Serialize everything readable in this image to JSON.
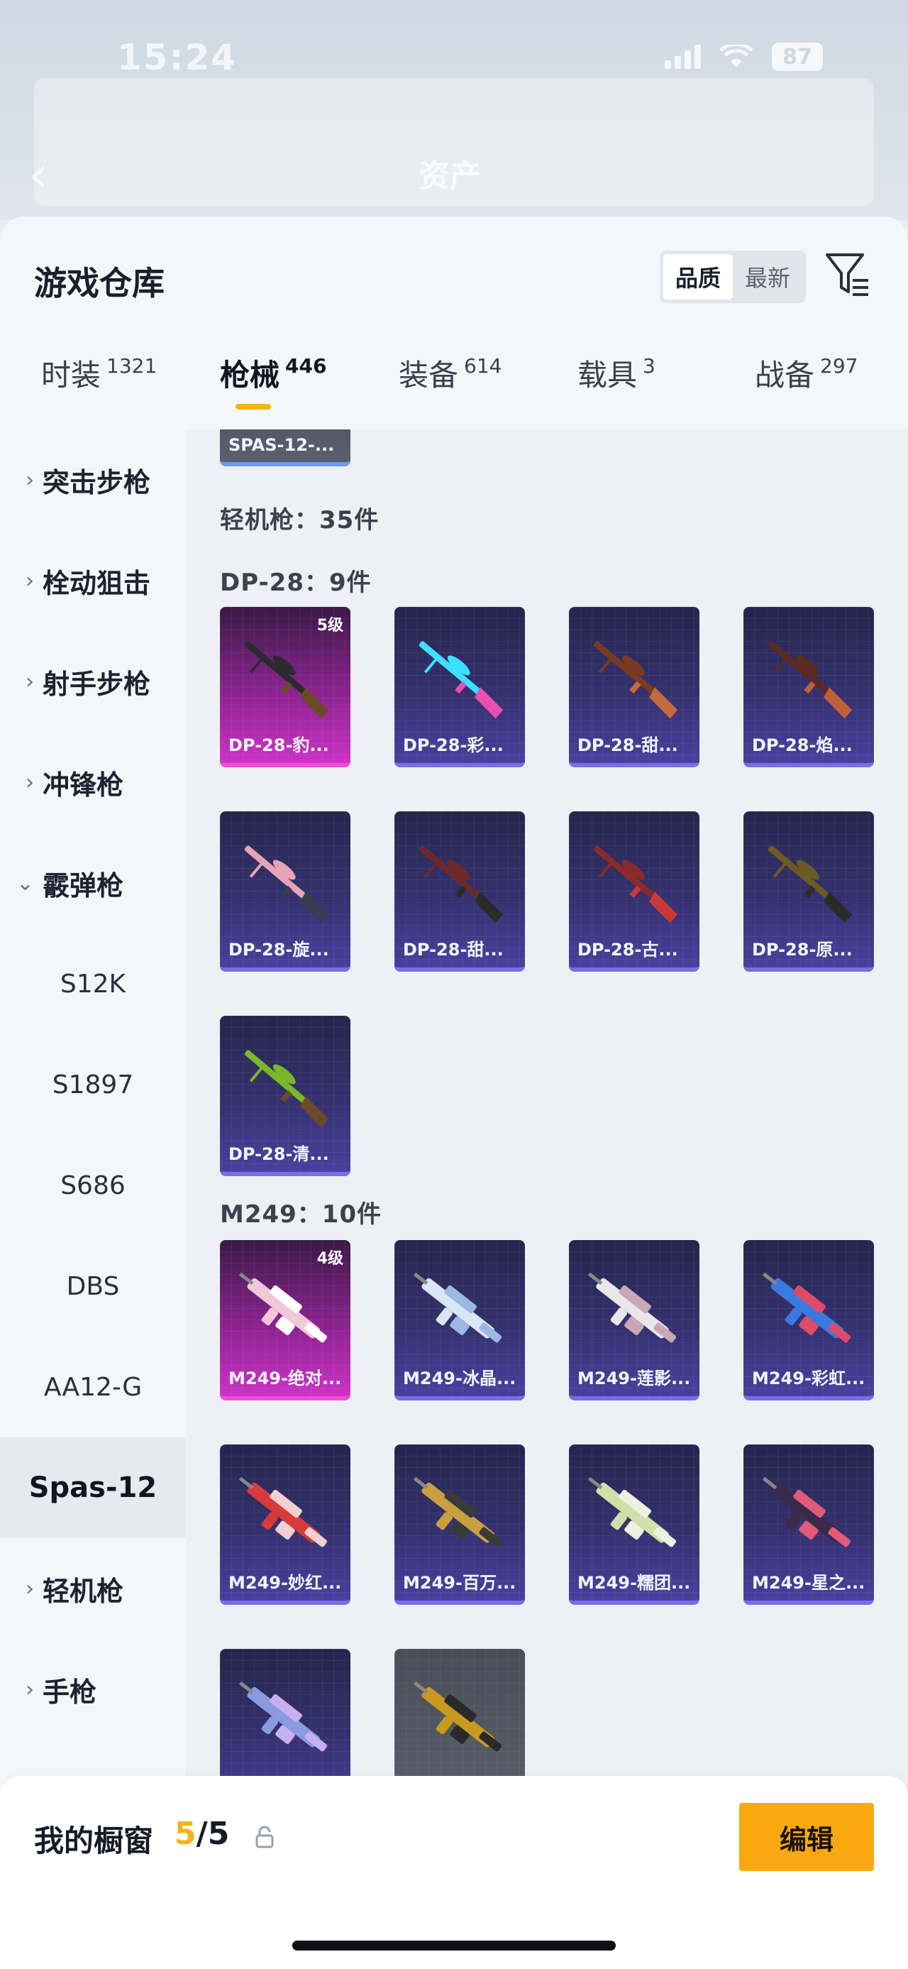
{
  "status_bar": {
    "time": "15:24",
    "battery": "87"
  },
  "header": {
    "back_label": "‹",
    "title": "资产"
  },
  "sheet": {
    "title": "游戏仓库",
    "sort_options": [
      "品质",
      "最新"
    ],
    "sort_selected": "品质"
  },
  "tabs": [
    {
      "label": "时装",
      "count": "1321"
    },
    {
      "label": "枪械",
      "count": "446"
    },
    {
      "label": "装备",
      "count": "614"
    },
    {
      "label": "载具",
      "count": "3"
    },
    {
      "label": "战备",
      "count": "297"
    }
  ],
  "sidebar": {
    "categories": [
      {
        "label": "突击步枪",
        "chevron": "›"
      },
      {
        "label": "栓动狙击",
        "chevron": "›"
      },
      {
        "label": "射手步枪",
        "chevron": "›"
      },
      {
        "label": "冲锋枪",
        "chevron": "›"
      },
      {
        "label": "霰弹枪",
        "chevron": "⌄"
      }
    ],
    "shotgun_items": [
      "S12K",
      "S1897",
      "S686",
      "DBS",
      "AA12-G",
      "Spas-12"
    ],
    "selected_item": "Spas-12",
    "more_categories": [
      {
        "label": "轻机枪",
        "chevron": "›"
      },
      {
        "label": "手枪",
        "chevron": "›"
      }
    ]
  },
  "main": {
    "top_card": {
      "name": "SPAS-12-..."
    },
    "lmg_summary": "轻机枪：35件",
    "groups": [
      {
        "heading": "DP-28：9件",
        "items": [
          {
            "name": "DP-28-豹...",
            "level": "5级",
            "tier": "pink"
          },
          {
            "name": "DP-28-彩...",
            "level": "",
            "tier": "purple"
          },
          {
            "name": "DP-28-甜...",
            "level": "",
            "tier": "purple"
          },
          {
            "name": "DP-28-焰...",
            "level": "",
            "tier": "purple"
          },
          {
            "name": "DP-28-旋...",
            "level": "",
            "tier": "purple"
          },
          {
            "name": "DP-28-甜...",
            "level": "",
            "tier": "purple"
          },
          {
            "name": "DP-28-古...",
            "level": "",
            "tier": "purple"
          },
          {
            "name": "DP-28-原...",
            "level": "",
            "tier": "purple"
          },
          {
            "name": "DP-28-清...",
            "level": "",
            "tier": "purple"
          }
        ]
      },
      {
        "heading": "M249：10件",
        "items": [
          {
            "name": "M249-绝对...",
            "level": "4级",
            "tier": "pink"
          },
          {
            "name": "M249-冰晶...",
            "level": "",
            "tier": "purple"
          },
          {
            "name": "M249-莲影...",
            "level": "",
            "tier": "purple"
          },
          {
            "name": "M249-彩虹...",
            "level": "",
            "tier": "purple"
          },
          {
            "name": "M249-妙红...",
            "level": "",
            "tier": "purple"
          },
          {
            "name": "M249-百万...",
            "level": "",
            "tier": "purple"
          },
          {
            "name": "M249-糯团...",
            "level": "",
            "tier": "purple"
          },
          {
            "name": "M249-星之...",
            "level": "",
            "tier": "purple"
          },
          {
            "name": "",
            "level": "",
            "tier": "purple"
          },
          {
            "name": "",
            "level": "",
            "tier": "grey"
          }
        ]
      }
    ]
  },
  "showcase": {
    "label": "我的橱窗",
    "current": "5",
    "total": "/5",
    "edit_label": "编辑"
  },
  "colors": {
    "accent": "#f5b21b",
    "pink_tier": "#cc32c4",
    "purple_tier": "#4a3f9e"
  },
  "icons": [
    "back-icon",
    "filter-icon",
    "share-icon",
    "lock-icon",
    "wifi-icon",
    "signal-icon",
    "battery-icon"
  ]
}
